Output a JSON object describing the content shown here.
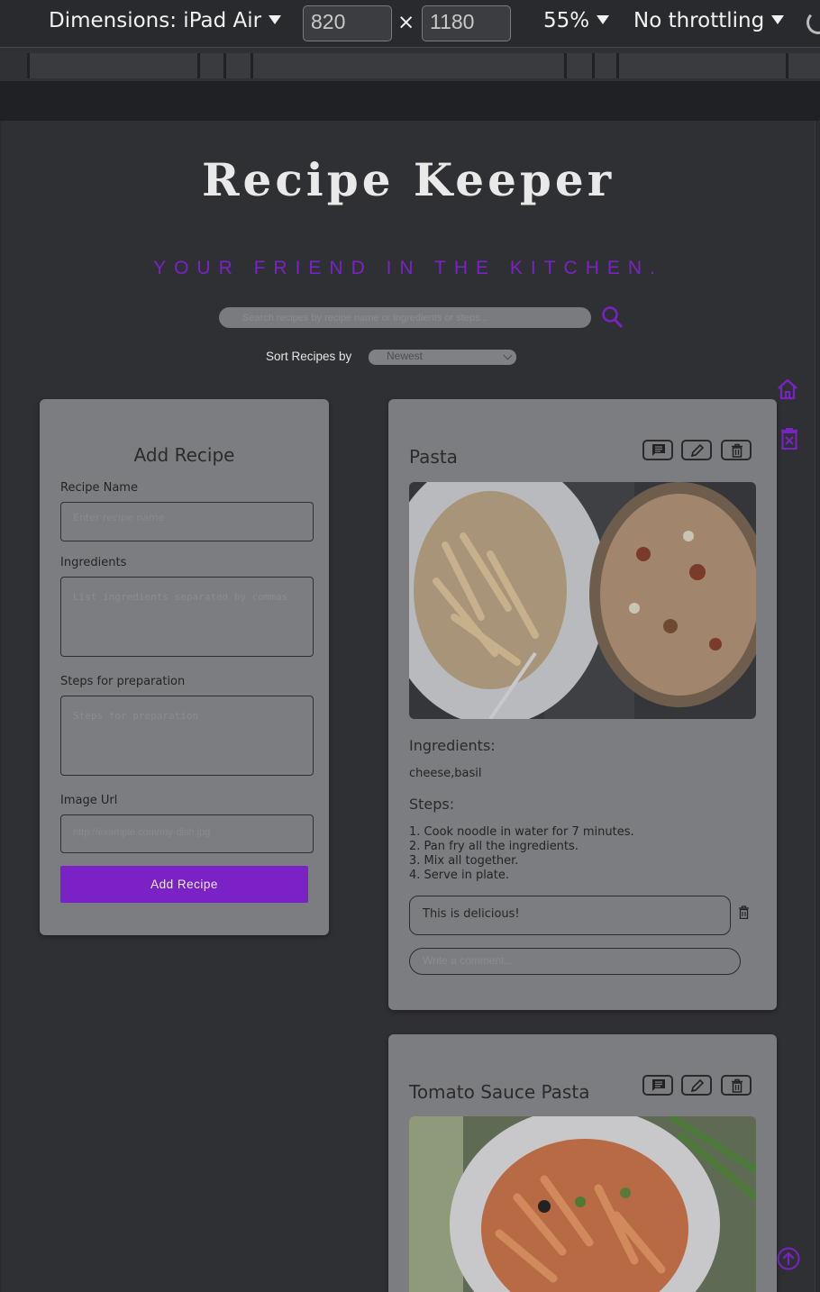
{
  "devtools": {
    "dimensions_label": "Dimensions: iPad Air",
    "width": "820",
    "height": "1180",
    "times": "×",
    "zoom": "55%",
    "throttling": "No throttling"
  },
  "header": {
    "title": "Recipe Keeper",
    "tagline": "YOUR FRIEND IN THE KITCHEN."
  },
  "search": {
    "placeholder": "Search recipes by recipe name or ingredients or steps..."
  },
  "sort": {
    "label": "Sort Recipes by",
    "selected": "Newest"
  },
  "form": {
    "title": "Add Recipe",
    "name_label": "Recipe Name",
    "name_placeholder": "Enter recipe name",
    "ingredients_label": "Ingredients",
    "ingredients_placeholder": "List ingredients separated by commas",
    "steps_label": "Steps for preparation",
    "steps_placeholder": "Steps for preparation",
    "image_label": "Image Url",
    "image_placeholder": "http://example.com/my-dish.jpg",
    "submit_label": "Add Recipe"
  },
  "recipes": [
    {
      "title": "Pasta",
      "ingredients_heading": "Ingredients:",
      "ingredients": "cheese,basil",
      "steps_heading": "Steps:",
      "steps": [
        "1. Cook noodle in water for 7 minutes.",
        "2. Pan fry all the ingredients.",
        "3. Mix all together.",
        "4. Serve in plate."
      ],
      "comment": "This is delicious!",
      "comment_placeholder": "Write a comment..."
    },
    {
      "title": "Tomato Sauce Pasta"
    }
  ],
  "colors": {
    "accent": "#7b22c6",
    "card": "#7c7d80",
    "page_background": "#2f3034"
  }
}
